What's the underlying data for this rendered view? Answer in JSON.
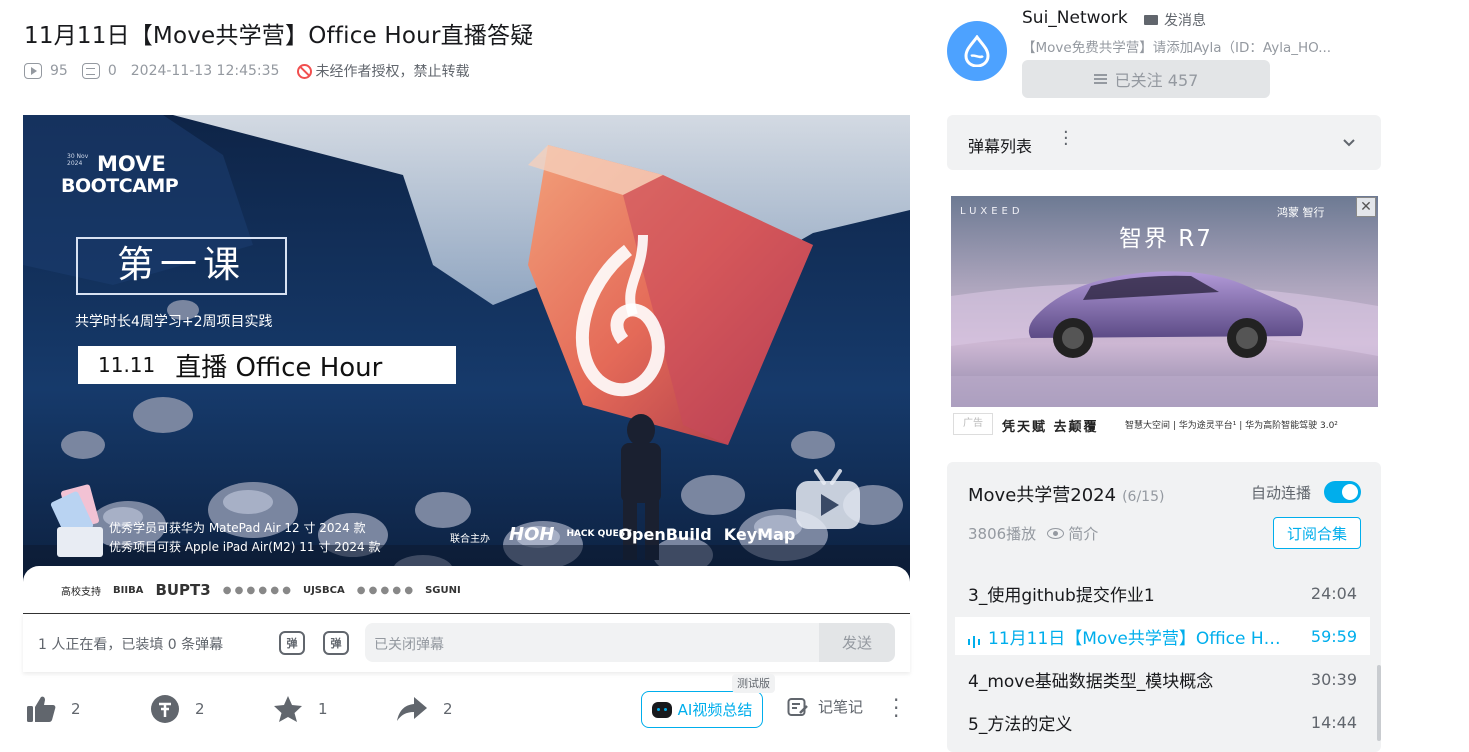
{
  "video": {
    "title": "11月11日【Move共学营】Office Hour直播答疑",
    "views": "95",
    "danmaku_count": "0",
    "publish_time": "2024-11-13 12:45:35",
    "copyright_notice": "未经作者授权，禁止转载"
  },
  "thumbnail": {
    "top_small": "30 Nov\n2024",
    "brand_line1": "MOVE",
    "brand_line2": "BOOTCAMP",
    "lesson": "第一课",
    "subtitle": "共学时长4周学习+2周项目实践",
    "live_date": "11.11",
    "live_label": "直播 Office Hour",
    "prize1": "优秀学员可获华为 MatePad Air 12 寸 2024 款",
    "prize2": "优秀项目可获 Apple iPad Air(M2) 11 寸 2024 款",
    "co_host_label": "联合主办",
    "hosts": [
      "HOH",
      "HACK QUEST",
      "OpenBuild",
      "KeyMap"
    ],
    "sponsor_label": "高校支持",
    "sponsors": [
      "BIIBA",
      "BUPT3",
      "UJSBCA",
      "SGUNI"
    ]
  },
  "player": {
    "viewers_text": "1 人正在看，已装填 0 条弹幕",
    "danmaku_icon_text": "弹",
    "danmaku_placeholder": "已关闭弹幕",
    "send_label": "发送"
  },
  "toolbar": {
    "like_count": "2",
    "coin_count": "2",
    "fav_count": "1",
    "share_count": "2",
    "ai_summary_label": "AI视频总结",
    "beta_label": "测试版",
    "notes_label": "记笔记"
  },
  "uploader": {
    "name": "Sui_Network",
    "message_label": "发消息",
    "description": "【Move免费共学营】请添加Ayla（ID：Ayla_HO...",
    "follow_label": "已关注 457"
  },
  "danmaku_list": {
    "title": "弹幕列表"
  },
  "ad": {
    "brand": "LUXEED",
    "title": "智界 R7",
    "brand2": "鸿蒙 智行",
    "tag": "广告",
    "slogan": "凭天赋  去颠覆",
    "features": "智慧大空间 | 华为途灵平台¹ | 华为高阶智能驾驶 3.0²"
  },
  "collection": {
    "title": "Move共学营2024",
    "progress": "(6/15)",
    "autoplay_label": "自动连播",
    "autoplay_on": true,
    "plays": "3806播放",
    "intro_label": "简介",
    "subscribe_label": "订阅合集",
    "episodes": [
      {
        "name": "3_使用github提交作业1",
        "duration": "24:04",
        "active": false
      },
      {
        "name": "11月11日【Move共学营】Office Hour直播答疑",
        "duration": "59:59",
        "active": true
      },
      {
        "name": "4_move基础数据类型_模块概念",
        "duration": "30:39",
        "active": false
      },
      {
        "name": "5_方法的定义",
        "duration": "14:44",
        "active": false
      }
    ]
  },
  "colors": {
    "accent": "#00aeec",
    "avatar": "#4da2ff"
  }
}
